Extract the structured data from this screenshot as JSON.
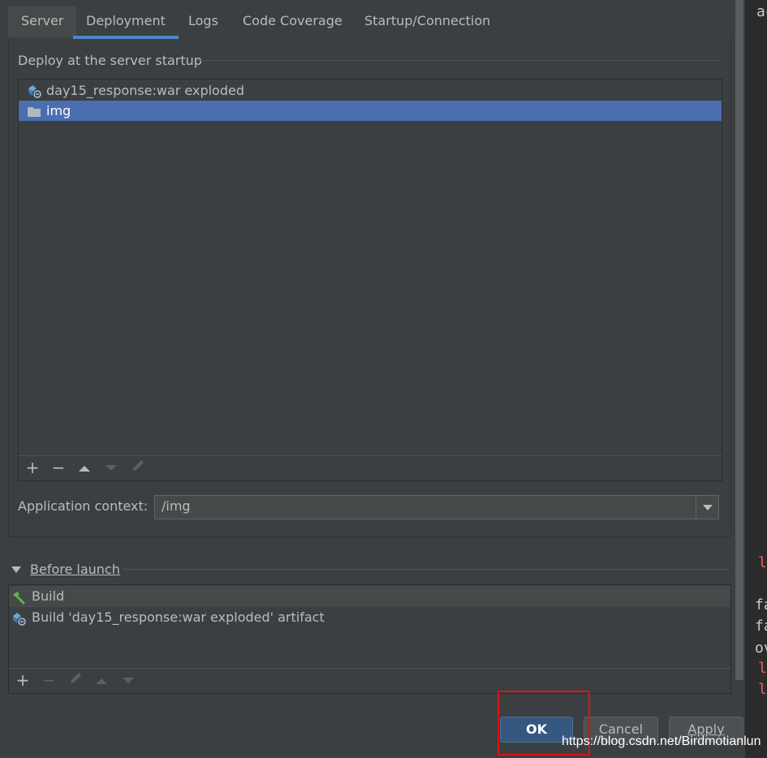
{
  "tabs": [
    {
      "label": "Server"
    },
    {
      "label": "Deployment"
    },
    {
      "label": "Logs"
    },
    {
      "label": "Code Coverage"
    },
    {
      "label": "Startup/Connection"
    }
  ],
  "deploy": {
    "title": "Deploy at the server startup",
    "items": [
      {
        "label": "day15_response:war exploded",
        "icon": "artifact-icon"
      },
      {
        "label": "img",
        "icon": "folder-icon",
        "selected": true
      }
    ],
    "toolbar": {
      "add": "+",
      "remove": "−"
    }
  },
  "app_context": {
    "label": "Application context:",
    "value": "/img"
  },
  "before_launch": {
    "title": "Before launch",
    "items": [
      {
        "label": "Build",
        "icon": "hammer-icon"
      },
      {
        "label": "Build 'day15_response:war exploded' artifact",
        "icon": "artifact-icon"
      }
    ],
    "toolbar": {
      "add": "+",
      "remove": "−"
    }
  },
  "buttons": {
    "ok": "OK",
    "cancel": "Cancel",
    "apply": "Apply"
  },
  "editor_fragments": [
    "ac",
    "l",
    "fa",
    "fa",
    "ov",
    "l",
    "l"
  ],
  "watermark": "https://blog.csdn.net/Birdmotianlun",
  "colors": {
    "accent": "#4a88c7",
    "selection": "#4b6eaf",
    "ok_button": "#365880",
    "highlight_box": "#e01010"
  }
}
